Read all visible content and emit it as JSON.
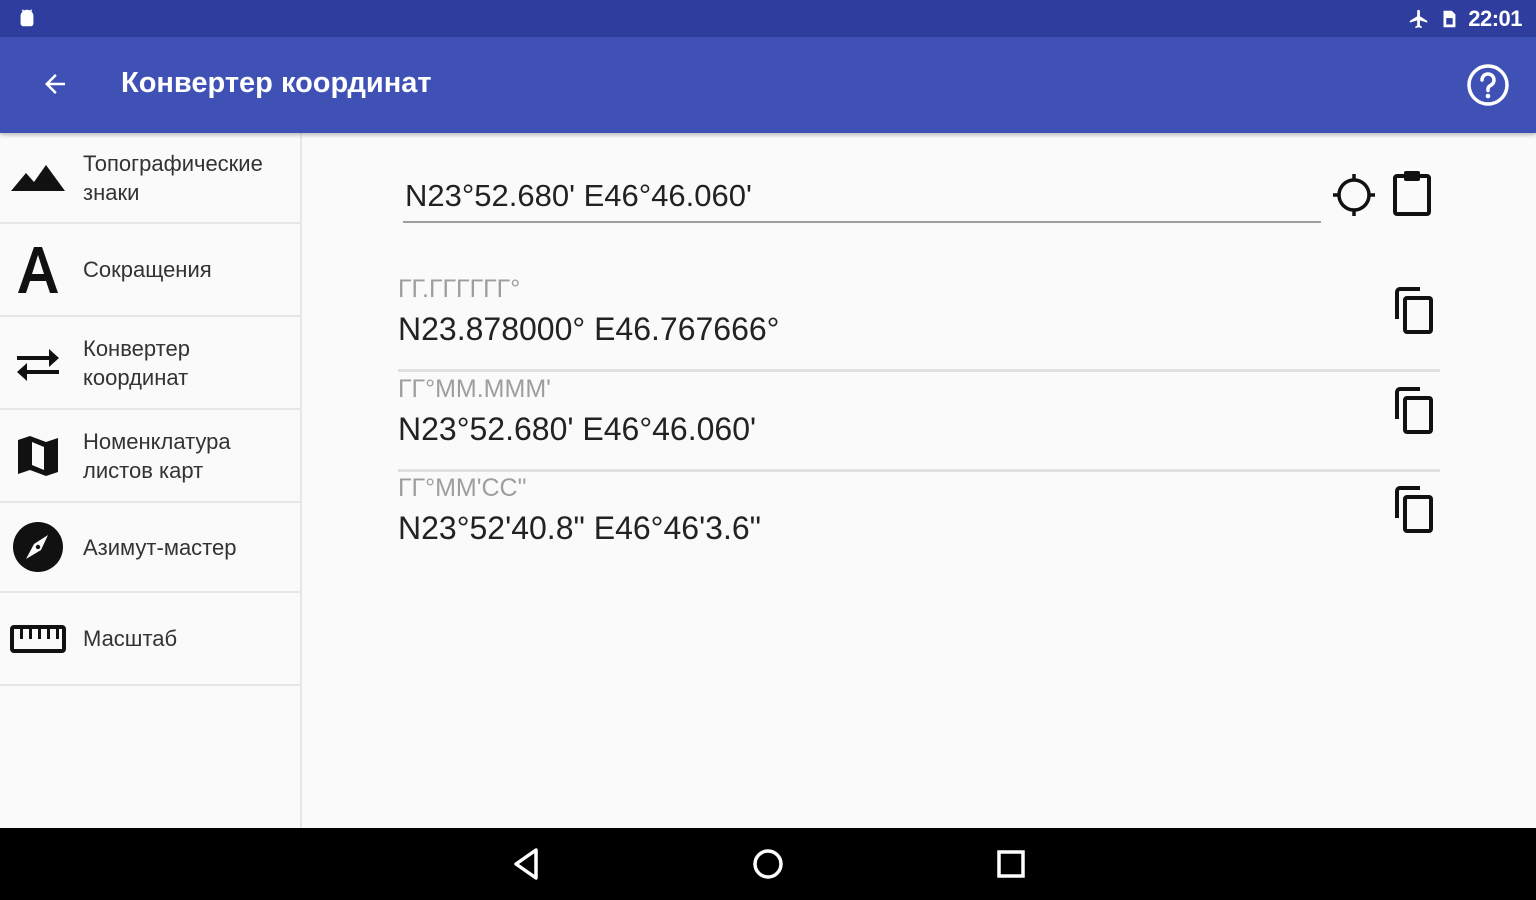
{
  "status_bar": {
    "time": "22:01",
    "left_icon": "android-icon",
    "icons": [
      "airplane-icon",
      "sim-card-icon"
    ]
  },
  "app_bar": {
    "title": "Конвертер координат",
    "back_icon": "arrow-back-icon",
    "help_icon": "help-circle-icon",
    "background": "#3f51b5",
    "status_background": "#2f3e9e"
  },
  "sidebar": {
    "items": [
      {
        "label": "Топографические\nзнаки",
        "icon": "mountains-icon"
      },
      {
        "label": "Сокращения",
        "icon": "letter-a-icon"
      },
      {
        "label": "Конвертер\nкоординат",
        "icon": "swap-arrows-icon"
      },
      {
        "label": "Номенклатура\nлистов карт",
        "icon": "map-icon"
      },
      {
        "label": "Азимут-мастер",
        "icon": "compass-icon"
      },
      {
        "label": "Масштаб",
        "icon": "ruler-icon"
      }
    ]
  },
  "input": {
    "value": "N23°52.680' E46°46.060'",
    "location_icon": "crosshair-icon",
    "paste_icon": "clipboard-icon"
  },
  "results": [
    {
      "label": "ГГ.ГГГГГГ°",
      "value": "N23.878000° E46.767666°",
      "icon": "copy-icon"
    },
    {
      "label": "ГГ°ММ.МММ'",
      "value": "N23°52.680' E46°46.060'",
      "icon": "copy-icon"
    },
    {
      "label": "ГГ°ММ'СС\"",
      "value": "N23°52'40.8\" E46°46'3.6\"",
      "icon": "copy-icon"
    }
  ],
  "system_nav": {
    "icons": [
      "nav-back-icon",
      "nav-home-icon",
      "nav-recents-icon"
    ]
  }
}
